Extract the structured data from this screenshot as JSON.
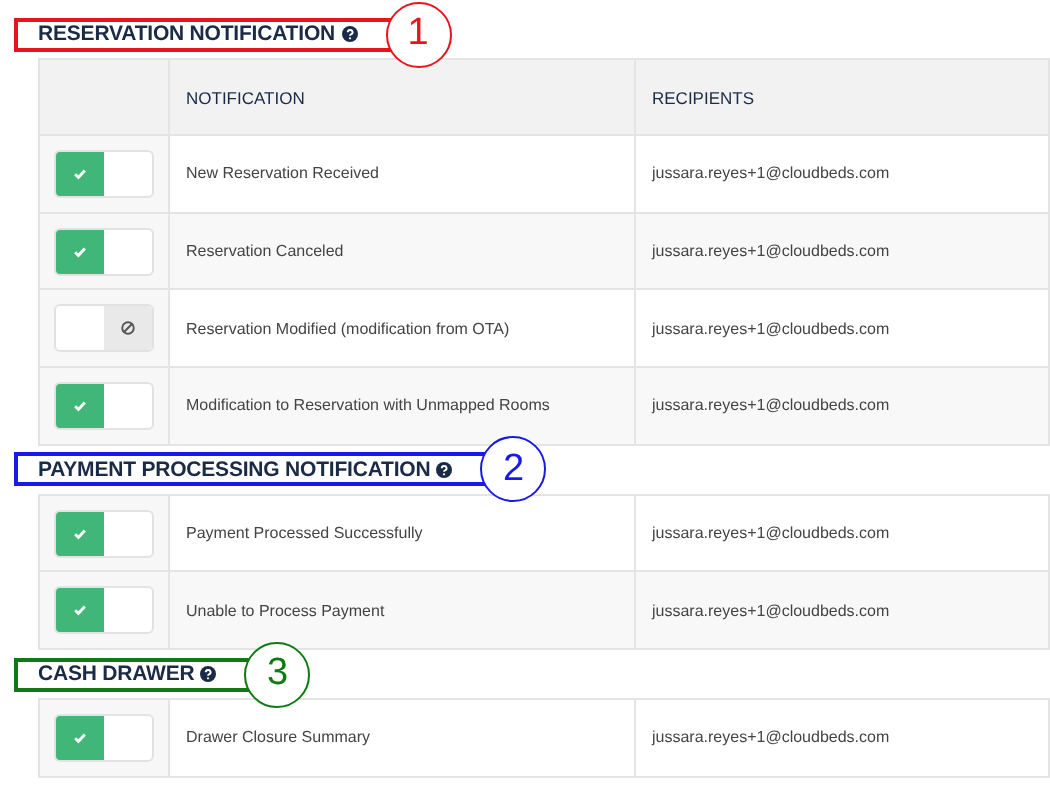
{
  "sections": [
    {
      "title": "RESERVATION NOTIFICATION",
      "annotation": {
        "number": "1",
        "color": "#e8141c"
      },
      "columns": [
        {
          "label": "NOTIFICATION"
        },
        {
          "label": "RECIPIENTS"
        }
      ],
      "rows": [
        {
          "on": true,
          "notification": "New Reservation Received",
          "recipients": "jussara.reyes+1@cloudbeds.com"
        },
        {
          "on": true,
          "notification": "Reservation Canceled",
          "recipients": "jussara.reyes+1@cloudbeds.com"
        },
        {
          "on": false,
          "notification": "Reservation Modified (modification from OTA)",
          "recipients": "jussara.reyes+1@cloudbeds.com"
        },
        {
          "on": true,
          "notification": "Modification to Reservation with Unmapped Rooms",
          "recipients": "jussara.reyes+1@cloudbeds.com"
        }
      ]
    },
    {
      "title": "PAYMENT PROCESSING NOTIFICATION",
      "annotation": {
        "number": "2",
        "color": "#1a1ae6"
      },
      "rows": [
        {
          "on": true,
          "notification": "Payment Processed Successfully",
          "recipients": "jussara.reyes+1@cloudbeds.com"
        },
        {
          "on": true,
          "notification": "Unable to Process Payment",
          "recipients": "jussara.reyes+1@cloudbeds.com"
        }
      ]
    },
    {
      "title": "CASH DRAWER",
      "annotation": {
        "number": "3",
        "color": "#0f7a14"
      },
      "rows": [
        {
          "on": true,
          "notification": "Drawer Closure Summary",
          "recipients": "jussara.reyes+1@cloudbeds.com"
        }
      ]
    }
  ]
}
